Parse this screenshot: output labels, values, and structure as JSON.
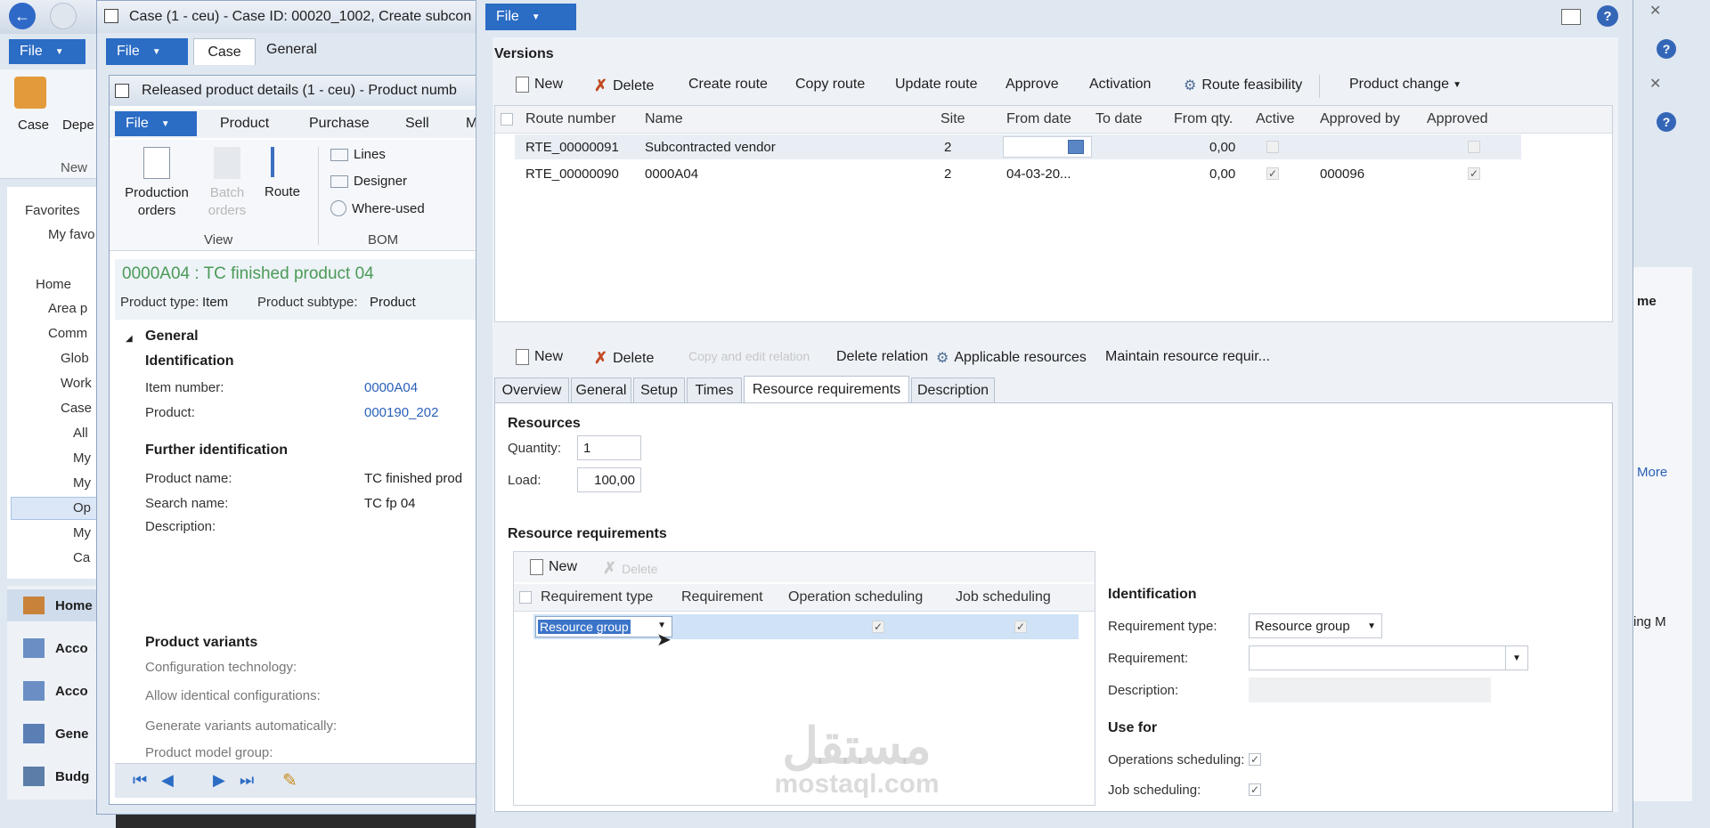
{
  "bg_window": {
    "file_label": "File",
    "case_label": "Case",
    "dep_label": "Depe",
    "new_label": "New",
    "nav": {
      "favorites": "Favorites",
      "my_fav": "My favo",
      "home": "Home",
      "area": "Area p",
      "comm": "Comm",
      "glob": "Glob",
      "work": "Work",
      "case": "Case",
      "all": "All",
      "my1": "My",
      "my2": "My",
      "op": "Op",
      "my3": "My",
      "ca": "Ca"
    },
    "modules": [
      "Home",
      "Acco",
      "Acco",
      "Gene",
      "Budg"
    ]
  },
  "case_window": {
    "title": "Case (1 - ceu) - Case ID: 00020_1002, Create subcon",
    "tabs": [
      "File",
      "Case",
      "General"
    ]
  },
  "product_window": {
    "title": "Released product details (1 - ceu) - Product numb",
    "menu": [
      "File",
      "Product",
      "Purchase",
      "Sell",
      "M"
    ],
    "ribbon": {
      "production_orders": "Production orders",
      "batch_orders": "Batch orders",
      "route": "Route",
      "view_group": "View",
      "lines": "Lines",
      "designer": "Designer",
      "where_used": "Where-used",
      "bom_group": "BOM"
    },
    "header": {
      "title": "0000A04 : TC finished product 04",
      "product_type_label": "Product type:",
      "product_type_value": "Item",
      "product_subtype_label": "Product subtype:",
      "product_subtype_value": "Product"
    },
    "general": {
      "section": "General",
      "identification": "Identification",
      "item_number_label": "Item number:",
      "item_number_value": "0000A04",
      "product_label": "Product:",
      "product_value": "000190_202",
      "further": "Further identification",
      "product_name_label": "Product name:",
      "product_name_value": "TC finished prod",
      "search_name_label": "Search name:",
      "search_name_value": "TC fp 04",
      "description_label": "Description:",
      "variants": "Product variants",
      "config_tech": "Configuration technology:",
      "allow_identical": "Allow identical configurations:",
      "generate_auto": "Generate variants automatically:",
      "model_group": "Product model group:"
    }
  },
  "route_window": {
    "file_label": "File",
    "versions_title": "Versions",
    "toolbar": [
      "New",
      "Delete",
      "Create route",
      "Copy route",
      "Update route",
      "Approve",
      "Activation",
      "Route feasibility",
      "Product change"
    ],
    "grid_headers": [
      "Route number",
      "Name",
      "Site",
      "From date",
      "To date",
      "From qty.",
      "Active",
      "Approved by",
      "Approved"
    ],
    "rows": [
      {
        "route": "RTE_00000091",
        "name": "Subcontracted vendor",
        "site": "2",
        "from_date": "",
        "to_date": "",
        "from_qty": "0,00",
        "active": false,
        "approved_by": "",
        "approved": false
      },
      {
        "route": "RTE_00000090",
        "name": "0000A04",
        "site": "2",
        "from_date": "04-03-20...",
        "to_date": "",
        "from_qty": "0,00",
        "active": true,
        "approved_by": "000096",
        "approved": true
      }
    ],
    "toolbar2": [
      "New",
      "Delete",
      "Copy and edit relation",
      "Delete relation",
      "Applicable resources",
      "Maintain resource requir..."
    ],
    "tabs": [
      "Overview",
      "General",
      "Setup",
      "Times",
      "Resource requirements",
      "Description"
    ],
    "active_tab": "Resource requirements",
    "resources": {
      "title": "Resources",
      "quantity_label": "Quantity:",
      "quantity_value": "1",
      "load_label": "Load:",
      "load_value": "100,00"
    },
    "requirements": {
      "title": "Resource requirements",
      "new_label": "New",
      "delete_label": "Delete",
      "headers": [
        "Requirement type",
        "Requirement",
        "Operation scheduling",
        "Job scheduling"
      ],
      "row": {
        "type": "Resource group",
        "requirement": "",
        "op_sched": true,
        "job_sched": true
      }
    },
    "identification": {
      "title": "Identification",
      "req_type_label": "Requirement type:",
      "req_type_value": "Resource group",
      "requirement_label": "Requirement:",
      "description_label": "Description:",
      "use_for": "Use for",
      "ops_label": "Operations scheduling:",
      "job_label": "Job scheduling:"
    }
  },
  "right_strip": {
    "me": "me",
    "more": "More",
    "ng": "ing M"
  },
  "watermark": {
    "arabic": "مستقل",
    "latin": "mostaql.com"
  }
}
